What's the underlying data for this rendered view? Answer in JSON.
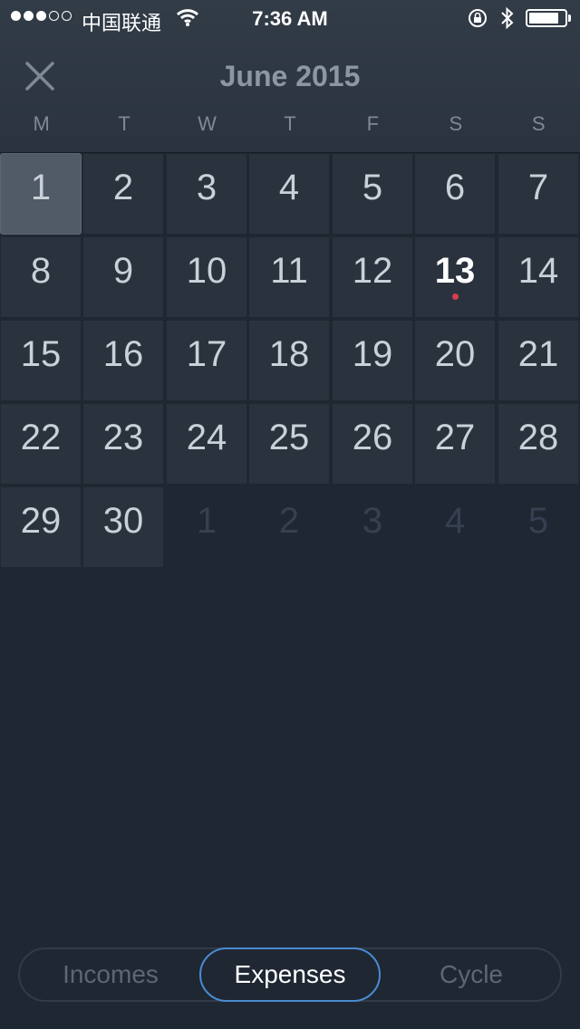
{
  "status_bar": {
    "carrier": "中国联通",
    "time": "7:36 AM"
  },
  "header": {
    "month_title": "June 2015",
    "weekdays": [
      "M",
      "T",
      "W",
      "T",
      "F",
      "S",
      "S"
    ]
  },
  "calendar": {
    "days": [
      {
        "label": "1",
        "state": "selected"
      },
      {
        "label": "2",
        "state": "normal"
      },
      {
        "label": "3",
        "state": "normal"
      },
      {
        "label": "4",
        "state": "normal"
      },
      {
        "label": "5",
        "state": "normal"
      },
      {
        "label": "6",
        "state": "normal"
      },
      {
        "label": "7",
        "state": "normal"
      },
      {
        "label": "8",
        "state": "normal"
      },
      {
        "label": "9",
        "state": "normal"
      },
      {
        "label": "10",
        "state": "normal"
      },
      {
        "label": "11",
        "state": "normal"
      },
      {
        "label": "12",
        "state": "normal"
      },
      {
        "label": "13",
        "state": "today"
      },
      {
        "label": "14",
        "state": "normal"
      },
      {
        "label": "15",
        "state": "normal"
      },
      {
        "label": "16",
        "state": "normal"
      },
      {
        "label": "17",
        "state": "normal"
      },
      {
        "label": "18",
        "state": "normal"
      },
      {
        "label": "19",
        "state": "normal"
      },
      {
        "label": "20",
        "state": "normal"
      },
      {
        "label": "21",
        "state": "normal"
      },
      {
        "label": "22",
        "state": "normal"
      },
      {
        "label": "23",
        "state": "normal"
      },
      {
        "label": "24",
        "state": "normal"
      },
      {
        "label": "25",
        "state": "normal"
      },
      {
        "label": "26",
        "state": "normal"
      },
      {
        "label": "27",
        "state": "normal"
      },
      {
        "label": "28",
        "state": "normal"
      },
      {
        "label": "29",
        "state": "normal"
      },
      {
        "label": "30",
        "state": "normal"
      },
      {
        "label": "1",
        "state": "muted"
      },
      {
        "label": "2",
        "state": "muted"
      },
      {
        "label": "3",
        "state": "muted"
      },
      {
        "label": "4",
        "state": "muted"
      },
      {
        "label": "5",
        "state": "muted"
      }
    ]
  },
  "segmented_control": {
    "tabs": [
      {
        "label": "Incomes",
        "active": false
      },
      {
        "label": "Expenses",
        "active": true
      },
      {
        "label": "Cycle",
        "active": false
      }
    ]
  },
  "colors": {
    "background": "#1f2733",
    "cell": "#2a323d",
    "selected_cell": "#505b67",
    "today_marker": "#d3404e",
    "segment_accent": "#4a8bd1"
  }
}
